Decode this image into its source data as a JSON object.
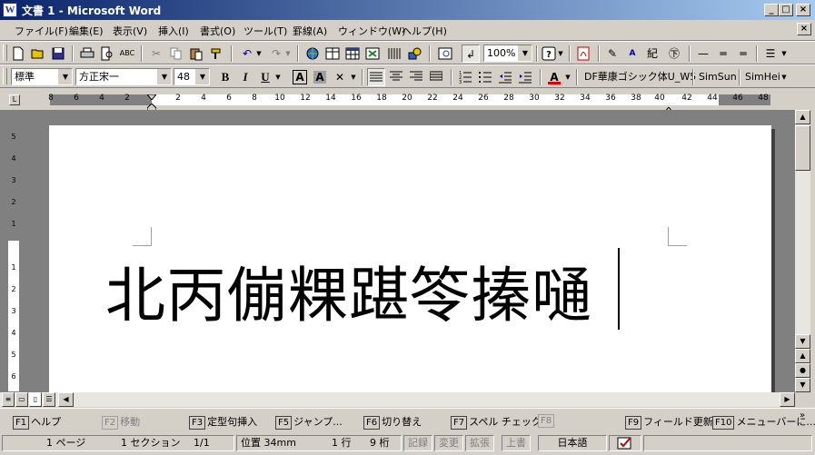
{
  "window": {
    "title": "文書 1 - Microsoft Word",
    "app_icon": "W",
    "minimize": "_",
    "maximize": "□",
    "close": "×"
  },
  "menu": {
    "items": [
      "ファイル(F)",
      "編集(E)",
      "表示(V)",
      "挿入(I)",
      "書式(O)",
      "ツール(T)",
      "罫線(A)",
      "ウィンドウ(W)",
      "ヘルプ(H)"
    ],
    "doc_close": "×"
  },
  "standard_toolbar": {
    "zoom": "100%",
    "help_icon": "?"
  },
  "format_toolbar": {
    "style": "標準",
    "font": "方正宋一",
    "size": "48",
    "bold": "B",
    "italic": "I",
    "underline": "U",
    "char_border": "A",
    "char_shading": "A",
    "font_color_glyph": "A",
    "font_color": "#e00000",
    "font_buttons": [
      "DF華康ゴシック体U_W5",
      "SimSun",
      "SimHei"
    ]
  },
  "ruler": {
    "numbers_left": [
      "8",
      "6",
      "4",
      "2"
    ],
    "numbers_right": [
      "2",
      "4",
      "6",
      "8",
      "10",
      "12",
      "14",
      "16",
      "18",
      "20",
      "22",
      "24",
      "26",
      "28",
      "30",
      "32",
      "34",
      "36",
      "38",
      "40",
      "42",
      "44",
      "46",
      "48"
    ],
    "vertical_numbers": [
      "5",
      "4",
      "3",
      "2",
      "1",
      "1",
      "2",
      "3",
      "4",
      "5",
      "6"
    ]
  },
  "document": {
    "text": "北丙傰粿踸笭搸嗵"
  },
  "function_keys": [
    {
      "key": "F1",
      "label": "ヘルプ",
      "enabled": true
    },
    {
      "key": "F2",
      "label": "移動",
      "enabled": false
    },
    {
      "key": "F3",
      "label": "定型句挿入",
      "enabled": true
    },
    {
      "key": "F5",
      "label": "ジャンプ...",
      "enabled": true
    },
    {
      "key": "F6",
      "label": "切り替え",
      "enabled": true
    },
    {
      "key": "F7",
      "label": "スペル チェック...",
      "enabled": true
    },
    {
      "key": "F8",
      "label": "",
      "enabled": false
    },
    {
      "key": "F9",
      "label": "フィールド更新",
      "enabled": true
    },
    {
      "key": "F10",
      "label": "メニューバーに...",
      "enabled": true
    }
  ],
  "status": {
    "page": "1 ページ",
    "section": "1 セクション",
    "pages": "1/1",
    "position": "位置 34mm",
    "line": "1 行",
    "column": "9 桁",
    "rec": "記録",
    "trk": "変更",
    "ext": "拡張",
    "ovr": "上書",
    "language": "日本語"
  }
}
